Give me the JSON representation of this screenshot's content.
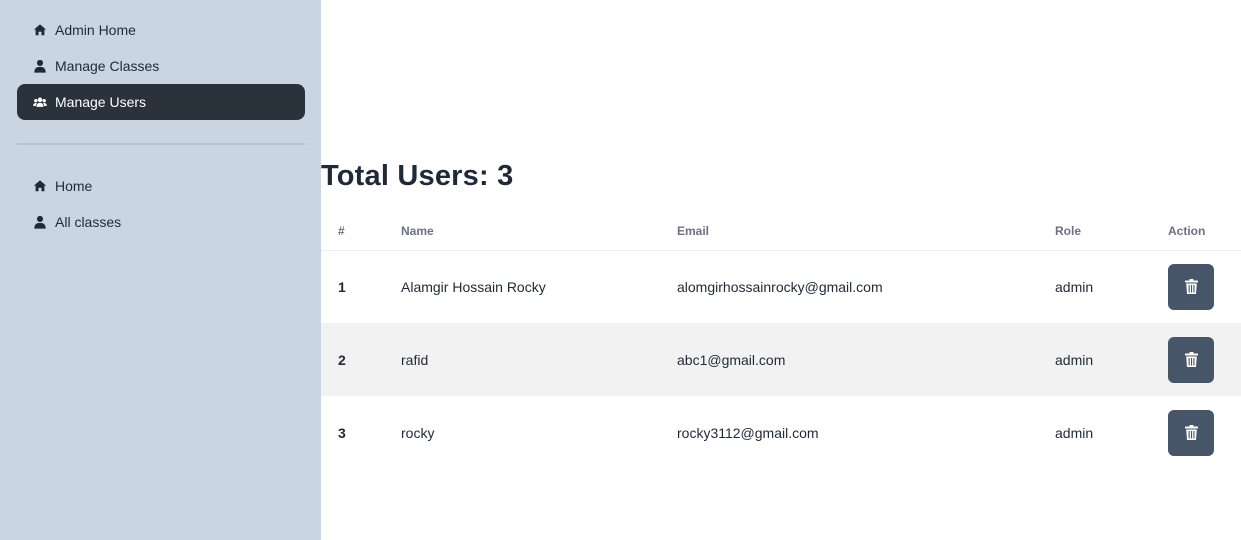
{
  "sidebar": {
    "top_items": [
      {
        "label": "Admin Home",
        "icon": "home-icon",
        "active": false
      },
      {
        "label": "Manage Classes",
        "icon": "user-icon",
        "active": false
      },
      {
        "label": "Manage Users",
        "icon": "users-icon",
        "active": true
      }
    ],
    "bottom_items": [
      {
        "label": "Home",
        "icon": "home-icon"
      },
      {
        "label": "All classes",
        "icon": "user-icon"
      }
    ]
  },
  "main": {
    "title": "Total Users: 3",
    "table": {
      "headers": {
        "num": "#",
        "name": "Name",
        "email": "Email",
        "role": "Role",
        "action": "Action"
      },
      "rows": [
        {
          "num": "1",
          "name": "Alamgir Hossain Rocky",
          "email": "alomgirhossainrocky@gmail.com",
          "role": "admin",
          "action_icon": "trash-icon"
        },
        {
          "num": "2",
          "name": "rafid",
          "email": "abc1@gmail.com",
          "role": "admin",
          "action_icon": "trash-icon"
        },
        {
          "num": "3",
          "name": "rocky",
          "email": "rocky3112@gmail.com",
          "role": "admin",
          "action_icon": "trash-icon"
        }
      ]
    }
  },
  "colors": {
    "sidebar_bg": "#cad5e2",
    "active_item_bg": "#2a323c",
    "delete_button_bg": "#475569",
    "alt_row_bg": "#f2f2f2"
  }
}
